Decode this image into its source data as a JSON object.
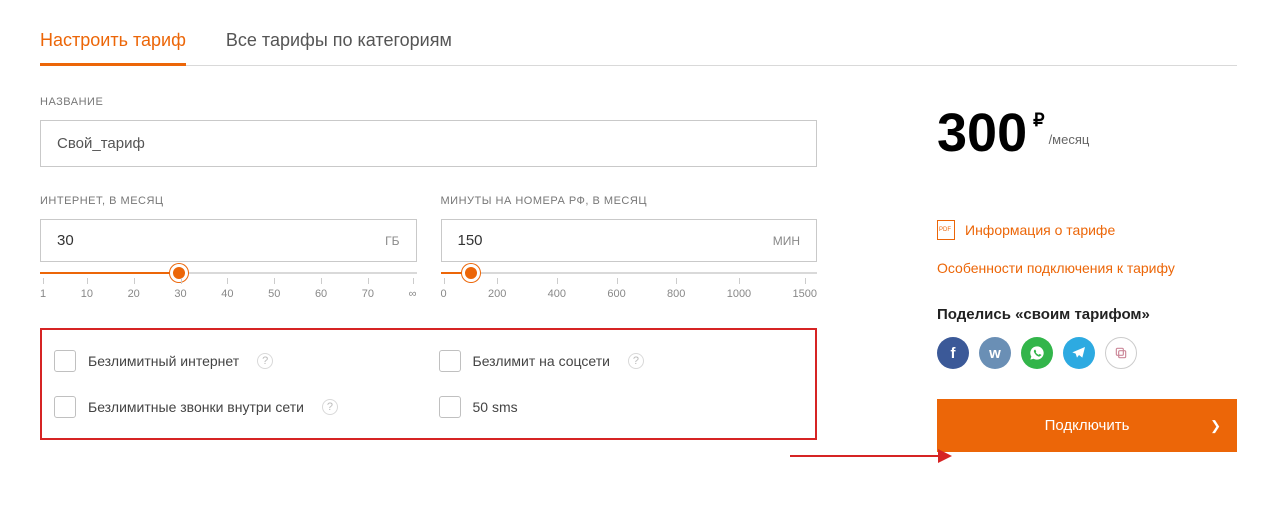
{
  "tabs": {
    "configure": "Настроить тариф",
    "all": "Все тарифы по категориям"
  },
  "name_field": {
    "label": "НАЗВАНИЕ",
    "value": "Свой_тариф"
  },
  "internet": {
    "label": "ИНТЕРНЕТ, В МЕСЯЦ",
    "value": "30",
    "unit": "ГБ",
    "ticks": [
      "1",
      "10",
      "20",
      "30",
      "40",
      "50",
      "60",
      "70",
      "∞"
    ],
    "fill_percent": 37
  },
  "minutes": {
    "label": "МИНУТЫ НА НОМЕРА РФ, В МЕСЯЦ",
    "value": "150",
    "unit": "МИН",
    "ticks": [
      "0",
      "200",
      "400",
      "600",
      "800",
      "1000",
      "1500"
    ],
    "fill_percent": 8
  },
  "options": {
    "unlimited_internet": "Безлимитный интернет",
    "unlimited_social": "Безлимит на соцсети",
    "unlimited_calls": "Безлимитные звонки внутри сети",
    "sms": "50 sms"
  },
  "price": {
    "amount": "300",
    "currency": "₽",
    "period": "/месяц"
  },
  "links": {
    "info": "Информация о тарифе",
    "features": "Особенности подключения к тарифу"
  },
  "share": {
    "title": "Поделись «своим тарифом»"
  },
  "cta": "Подключить"
}
